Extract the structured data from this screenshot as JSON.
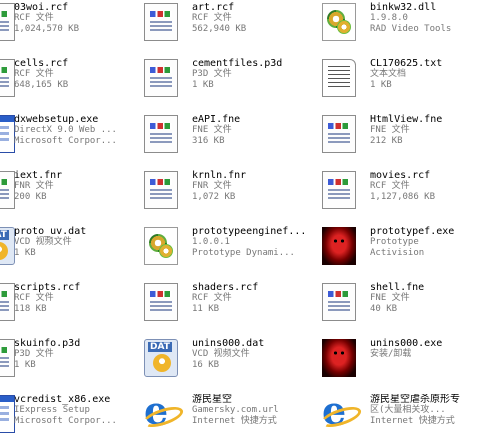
{
  "files": [
    {
      "name": "03woi.rcf",
      "type": "RCF 文件",
      "detail": "1,024,570 KB",
      "icon": "generic-file-icon"
    },
    {
      "name": "art.rcf",
      "type": "RCF 文件",
      "detail": "562,940 KB",
      "icon": "generic-file-icon"
    },
    {
      "name": "binkw32.dll",
      "type": "1.9.8.0",
      "detail": "RAD Video Tools",
      "icon": "dll-file-icon"
    },
    {
      "name": "cells.rcf",
      "type": "RCF 文件",
      "detail": "648,165 KB",
      "icon": "generic-file-icon"
    },
    {
      "name": "cementfiles.p3d",
      "type": "P3D 文件",
      "detail": "1 KB",
      "icon": "generic-file-icon"
    },
    {
      "name": "CL170625.txt",
      "type": "文本文档",
      "detail": "1 KB",
      "icon": "text-document-icon"
    },
    {
      "name": "dxwebsetup.exe",
      "type": "DirectX 9.0 Web ...",
      "detail": "Microsoft Corpor...",
      "icon": "exe-window-icon"
    },
    {
      "name": "eAPI.fne",
      "type": "FNE 文件",
      "detail": "316 KB",
      "icon": "generic-file-icon"
    },
    {
      "name": "HtmlView.fne",
      "type": "FNE 文件",
      "detail": "212 KB",
      "icon": "generic-file-icon"
    },
    {
      "name": "iext.fnr",
      "type": "FNR 文件",
      "detail": "200 KB",
      "icon": "generic-file-icon"
    },
    {
      "name": "krnln.fnr",
      "type": "FNR 文件",
      "detail": "1,072 KB",
      "icon": "generic-file-icon"
    },
    {
      "name": "movies.rcf",
      "type": "RCF 文件",
      "detail": "1,127,086 KB",
      "icon": "generic-file-icon"
    },
    {
      "name": "proto_uv.dat",
      "type": "VCD 视频文件",
      "detail": "1 KB",
      "icon": "media-file-icon"
    },
    {
      "name": "prototypeenginef...",
      "type": "1.0.0.1",
      "detail": "Prototype Dynami...",
      "icon": "dll-file-icon"
    },
    {
      "name": "prototypef.exe",
      "type": "Prototype",
      "detail": "Activision",
      "icon": "prototype-face-icon"
    },
    {
      "name": "scripts.rcf",
      "type": "RCF 文件",
      "detail": "118 KB",
      "icon": "generic-file-icon"
    },
    {
      "name": "shaders.rcf",
      "type": "RCF 文件",
      "detail": "11 KB",
      "icon": "generic-file-icon"
    },
    {
      "name": "shell.fne",
      "type": "FNE 文件",
      "detail": "40 KB",
      "icon": "generic-file-icon"
    },
    {
      "name": "skuinfo.p3d",
      "type": "P3D 文件",
      "detail": "1 KB",
      "icon": "generic-file-icon"
    },
    {
      "name": "unins000.dat",
      "type": "VCD 视频文件",
      "detail": "16 KB",
      "icon": "dat-media-icon"
    },
    {
      "name": "unins000.exe",
      "type": "安装/卸载",
      "detail": "",
      "icon": "prototype-face-icon"
    },
    {
      "name": "vcredist_x86.exe",
      "type": "IExpress Setup",
      "detail": "Microsoft Corpor...",
      "icon": "exe-window-icon"
    },
    {
      "name": "游民星空",
      "type": "Gamersky.com.url",
      "detail": "Internet 快捷方式",
      "icon": "browser-shortcut-icon"
    },
    {
      "name": "游民星空虐杀原形专",
      "type": "区(大量相关攻...",
      "detail": "Internet 快捷方式",
      "icon": "browser-shortcut-icon"
    }
  ]
}
